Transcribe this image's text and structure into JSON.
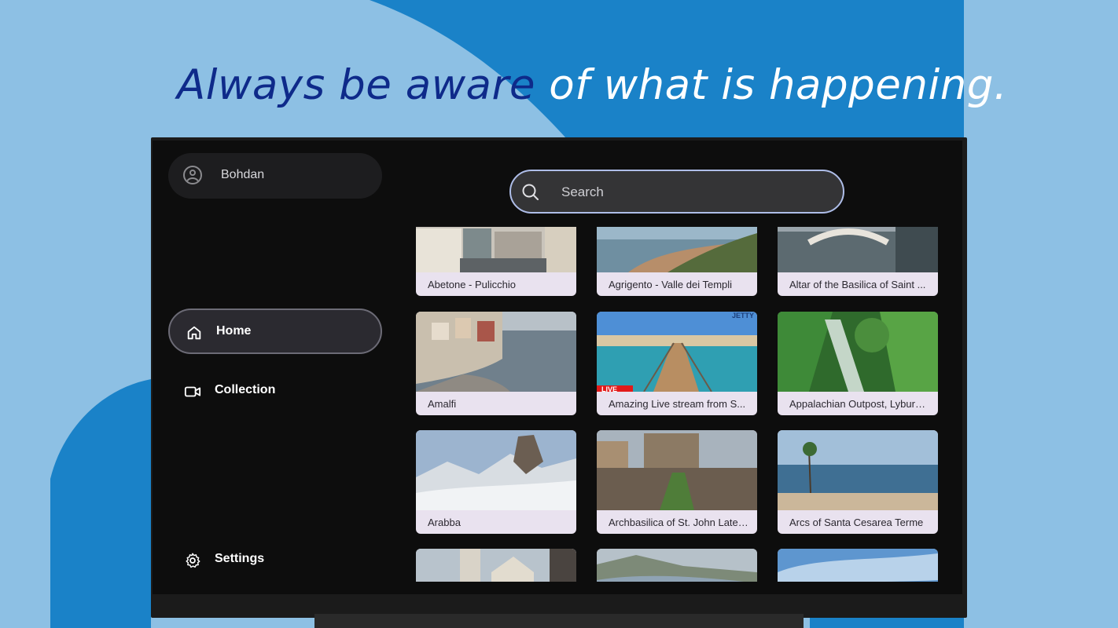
{
  "headline": {
    "part_dark": "Always be aware ",
    "part_light": "of what is happening."
  },
  "profile": {
    "name": "Bohdan",
    "avatar_icon": "account-circle-icon"
  },
  "nav": {
    "items": [
      {
        "label": "Home",
        "icon": "home-icon",
        "active": true
      },
      {
        "label": "Collection",
        "icon": "video-camera-icon",
        "active": false
      }
    ],
    "settings": {
      "label": "Settings",
      "icon": "gear-icon"
    }
  },
  "search": {
    "placeholder": "Search",
    "value": ""
  },
  "cards": [
    {
      "title": "Abetone - Pulicchio"
    },
    {
      "title": "Agrigento - Valle dei Templi"
    },
    {
      "title": "Altar of the Basilica of Saint ..."
    },
    {
      "title": "Amalfi"
    },
    {
      "title": "Amazing Live stream from S...",
      "badge": "LIVE",
      "logo": "JETTY"
    },
    {
      "title": "Appalachian Outpost, Lyburn,..."
    },
    {
      "title": "Arabba"
    },
    {
      "title": "Archbasilica of St. John Later..."
    },
    {
      "title": "Arcs of Santa Cesarea Terme"
    },
    {
      "title": ""
    },
    {
      "title": ""
    },
    {
      "title": ""
    }
  ],
  "colors": {
    "background": "#8dc0e4",
    "blob": "#1a82c8",
    "headline_dark": "#0e2a8a",
    "screen": "#0d0d0d",
    "card_caption_bg": "#e9e2ef",
    "search_border": "#aebde8",
    "live_badge": "#e21a1a"
  }
}
